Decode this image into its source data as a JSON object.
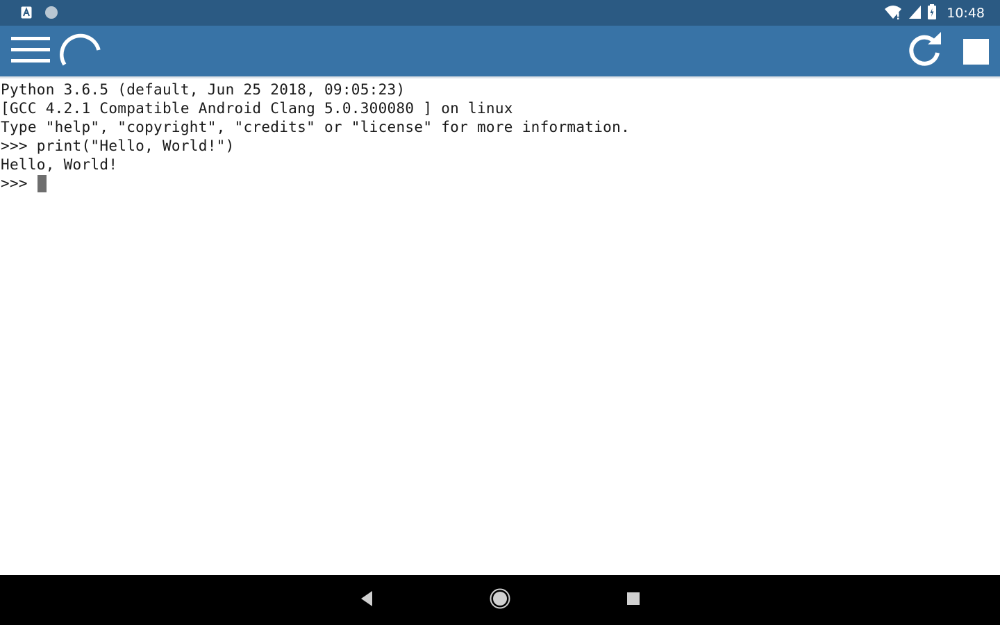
{
  "status_bar": {
    "time": "10:48",
    "left_icons": [
      "android-notification-icon",
      "circle-notification-icon"
    ],
    "right_icons": [
      "wifi-icon",
      "cellular-signal-icon",
      "battery-icon"
    ],
    "background": "#2b5a83"
  },
  "toolbar": {
    "background": "#3873a6",
    "left_icons": [
      "hamburger-menu-icon",
      "loading-spinner-icon"
    ],
    "right_icons": [
      "refresh-icon",
      "stop-icon"
    ]
  },
  "console": {
    "banner": [
      "Python 3.6.5 (default, Jun 25 2018, 09:05:23)",
      "[GCC 4.2.1 Compatible Android Clang 5.0.300080 ] on linux",
      "Type \"help\", \"copyright\", \"credits\" or \"license\" for more information."
    ],
    "command_line": ">>> print(\"Hello, World!\")",
    "output_line": "Hello, World!",
    "prompt": ">>> ",
    "input_value": ""
  },
  "nav_bar": {
    "buttons": [
      "back-icon",
      "home-icon",
      "recents-icon"
    ]
  }
}
